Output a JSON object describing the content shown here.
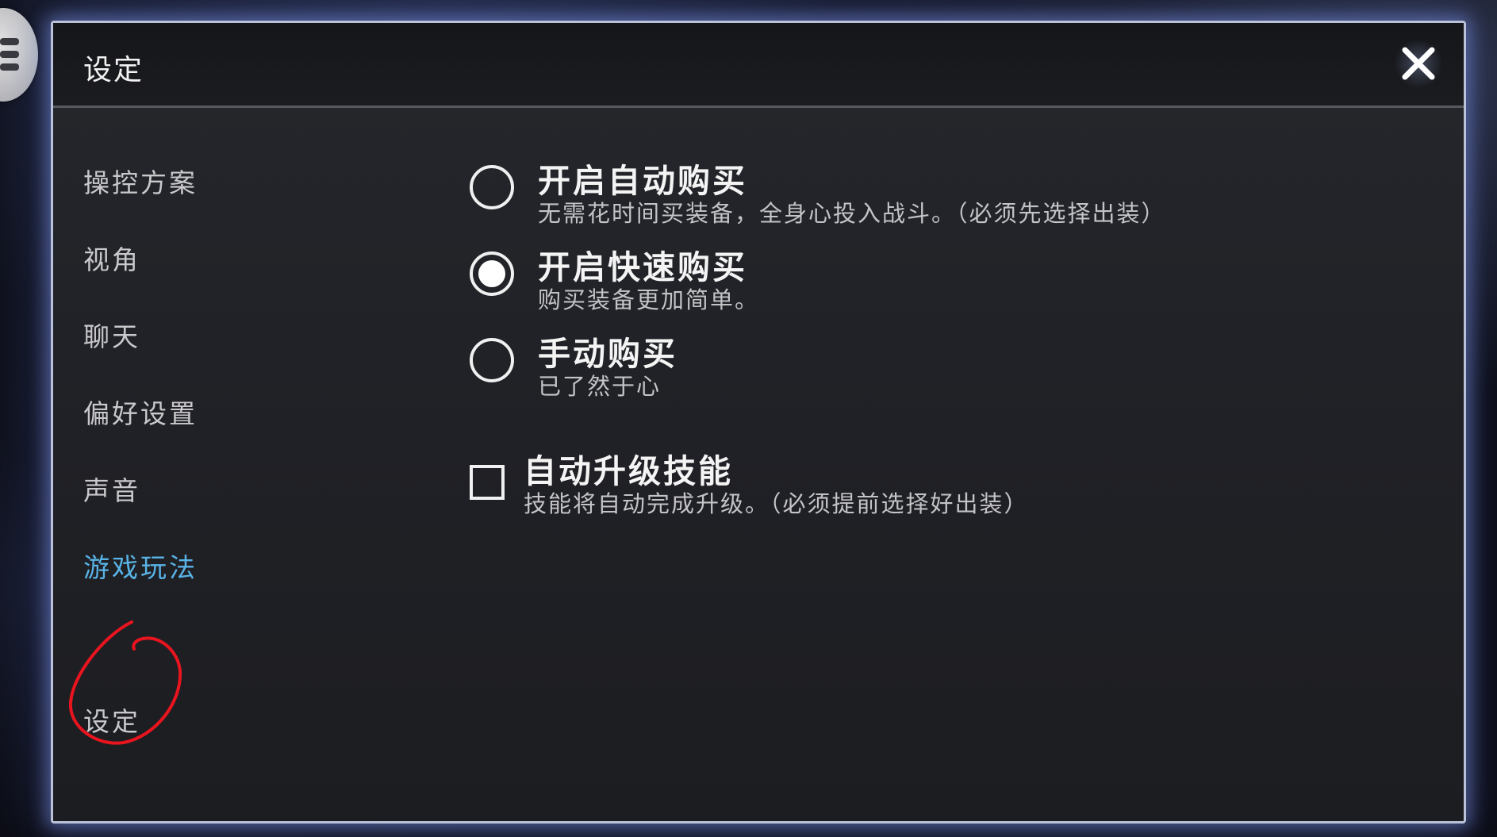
{
  "window": {
    "title": "设定",
    "close_icon": "close-icon"
  },
  "sidebar": {
    "items": [
      {
        "label": "操控方案",
        "active": false
      },
      {
        "label": "视角",
        "active": false
      },
      {
        "label": "聊天",
        "active": false
      },
      {
        "label": "偏好设置",
        "active": false
      },
      {
        "label": "声音",
        "active": false
      },
      {
        "label": "游戏玩法",
        "active": true
      },
      {
        "label": "设定",
        "active": false
      }
    ]
  },
  "purchase_mode": {
    "selected": "开启快速购买",
    "options": [
      {
        "title": "开启自动购买",
        "description": "无需花时间买装备，全身心投入战斗。（必须先选择出装）",
        "checked": false
      },
      {
        "title": "开启快速购买",
        "description": "购买装备更加简单。",
        "checked": true
      },
      {
        "title": "手动购买",
        "description": "已了然于心",
        "checked": false
      }
    ]
  },
  "auto_skill": {
    "title": "自动升级技能",
    "description": "技能将自动完成升级。（必须提前选择好出装）",
    "checked": false
  },
  "colors": {
    "active_tab": "#5ab3e6",
    "annotation_circle": "#e8141e",
    "panel_glow": "#b9c2d8"
  }
}
